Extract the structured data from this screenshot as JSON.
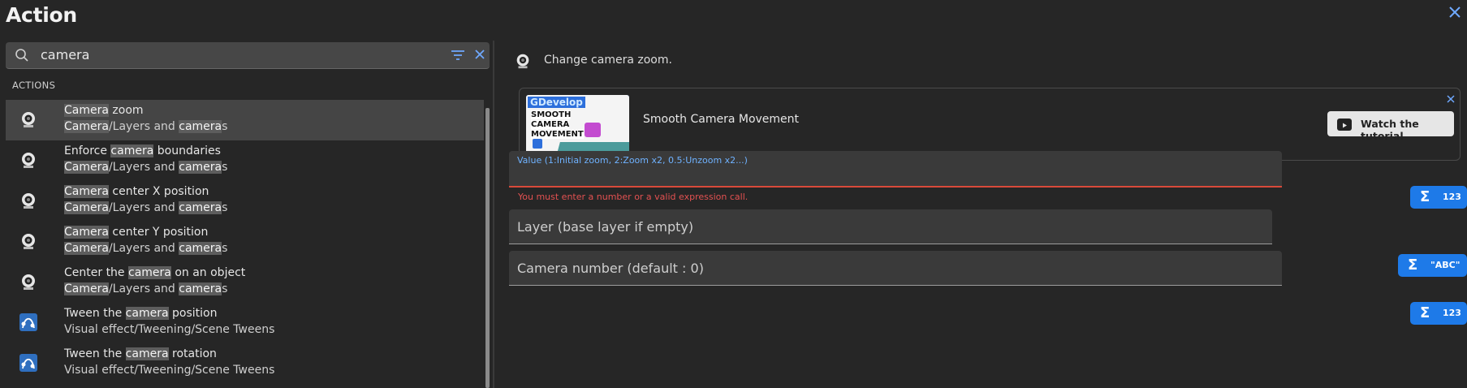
{
  "dialog": {
    "title": "Action"
  },
  "search": {
    "value": "camera"
  },
  "section_label": "ACTIONS",
  "actions": [
    {
      "icon": "camera-icon",
      "title_pre": "",
      "title_hl": "Camera",
      "title_post": " zoom",
      "cat_a": "Camera",
      "cat_mid": "/Layers and ",
      "cat_b": "camera",
      "cat_post": "s",
      "selected": true
    },
    {
      "icon": "camera-icon",
      "title_pre": "Enforce ",
      "title_hl": "camera",
      "title_post": " boundaries",
      "cat_a": "Camera",
      "cat_mid": "/Layers and ",
      "cat_b": "camera",
      "cat_post": "s"
    },
    {
      "icon": "camera-icon",
      "title_pre": "",
      "title_hl": "Camera",
      "title_post": " center X position",
      "cat_a": "Camera",
      "cat_mid": "/Layers and ",
      "cat_b": "camera",
      "cat_post": "s"
    },
    {
      "icon": "camera-icon",
      "title_pre": "",
      "title_hl": "Camera",
      "title_post": " center Y position",
      "cat_a": "Camera",
      "cat_mid": "/Layers and ",
      "cat_b": "camera",
      "cat_post": "s"
    },
    {
      "icon": "camera-icon",
      "title_pre": "Center the ",
      "title_hl": "camera",
      "title_post": " on an object",
      "cat_a": "Camera",
      "cat_mid": "/Layers and ",
      "cat_b": "camera",
      "cat_post": "s"
    },
    {
      "icon": "tween-icon",
      "title_pre": "Tween the ",
      "title_hl": "camera",
      "title_post": " position",
      "category": "Visual effect/Tweening/Scene Tweens"
    },
    {
      "icon": "tween-icon",
      "title_pre": "Tween the ",
      "title_hl": "camera",
      "title_post": " rotation",
      "category": "Visual effect/Tweening/Scene Tweens"
    }
  ],
  "detail": {
    "description": "Change camera zoom.",
    "tutorial": {
      "thumb_brand": "GDevelop",
      "thumb_lines": [
        "SMOOTH",
        "CAMERA",
        "MOVEMENT"
      ],
      "title": "Smooth Camera Movement",
      "watch_label": "Watch the tutorial"
    },
    "fields": {
      "value_label": "Value (1:Initial zoom, 2:Zoom x2, 0.5:Unzoom x2...)",
      "value_error": "You must enter a number or a valid expression call.",
      "layer_label": "Layer (base layer if empty)",
      "camera_label": "Camera number (default : 0)"
    },
    "expr_buttons": {
      "number": "123",
      "string": "\"ABC\""
    }
  },
  "colors": {
    "accent": "#1e7ae8",
    "error": "#e35151",
    "background": "#262626"
  }
}
